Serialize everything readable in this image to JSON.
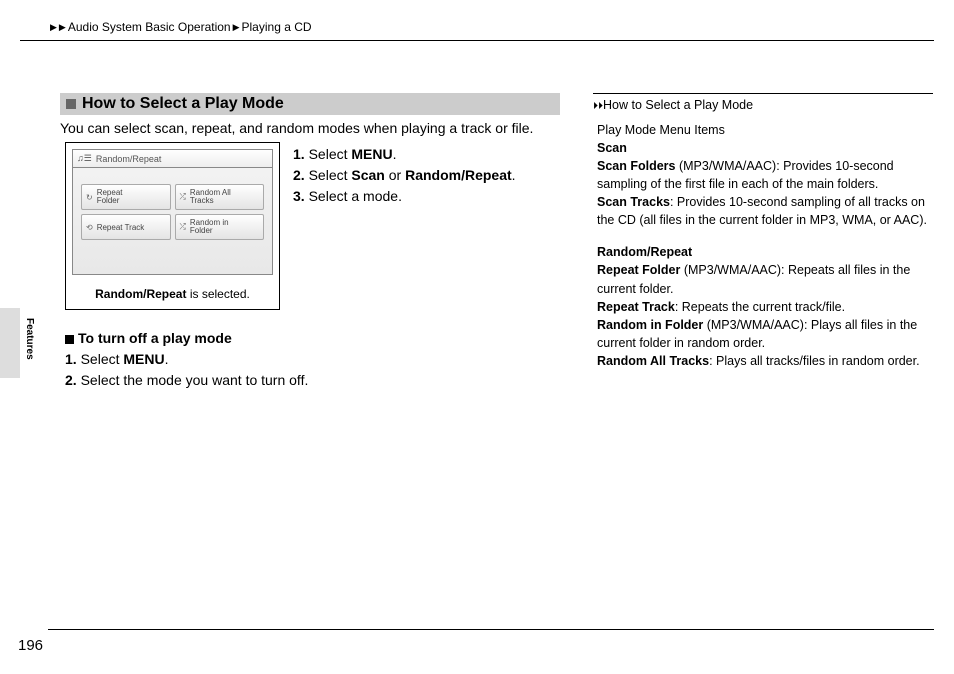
{
  "breadcrumb": {
    "a": "Audio System Basic Operation",
    "b": "Playing a CD"
  },
  "tab": "Features",
  "section": {
    "title": "How to Select a Play Mode"
  },
  "intro": "You can select scan, repeat, and random modes when playing a track or file.",
  "figure": {
    "header": "Random/Repeat",
    "btn1": "Repeat\nFolder",
    "btn2": "Random All\nTracks",
    "btn3": "Repeat Track",
    "btn4": "Random in\nFolder",
    "caption_bold": "Random/Repeat",
    "caption_rest": " is selected."
  },
  "steps": {
    "s1a": "1. ",
    "s1b": "Select ",
    "s1c": "MENU",
    "s1d": ".",
    "s2a": "2. ",
    "s2b": "Select ",
    "s2c": "Scan",
    "s2d": " or ",
    "s2e": "Random/Repeat",
    "s2f": ".",
    "s3a": "3. ",
    "s3b": "Select a mode."
  },
  "turnoff": {
    "title": "To turn off a play mode",
    "l1a": "1. ",
    "l1b": "Select ",
    "l1c": "MENU",
    "l1d": ".",
    "l2a": "2. ",
    "l2b": "Select the mode you want to turn off."
  },
  "sidebar": {
    "heading": "How to Select a Play Mode",
    "p1": "Play Mode Menu Items",
    "scan": "Scan",
    "sf_b": "Scan Folders",
    "sf_r": " (MP3/WMA/AAC): Provides 10-second sampling of the first file in each of the main folders.",
    "st_b": "Scan Tracks",
    "st_r": ": Provides 10-second sampling of all tracks on the CD (all files in the current folder in MP3, WMA, or AAC).",
    "rr": "Random/Repeat",
    "rf_b": "Repeat Folder",
    "rf_r": " (MP3/WMA/AAC): Repeats all files in the current folder.",
    "rt_b": "Repeat Track",
    "rt_r": ": Repeats the current track/file.",
    "rif_b": "Random in Folder",
    "rif_r": " (MP3/WMA/AAC): Plays all files in the current folder in random order.",
    "rat_b": "Random All Tracks",
    "rat_r": ": Plays all tracks/files in random order."
  },
  "page": "196"
}
